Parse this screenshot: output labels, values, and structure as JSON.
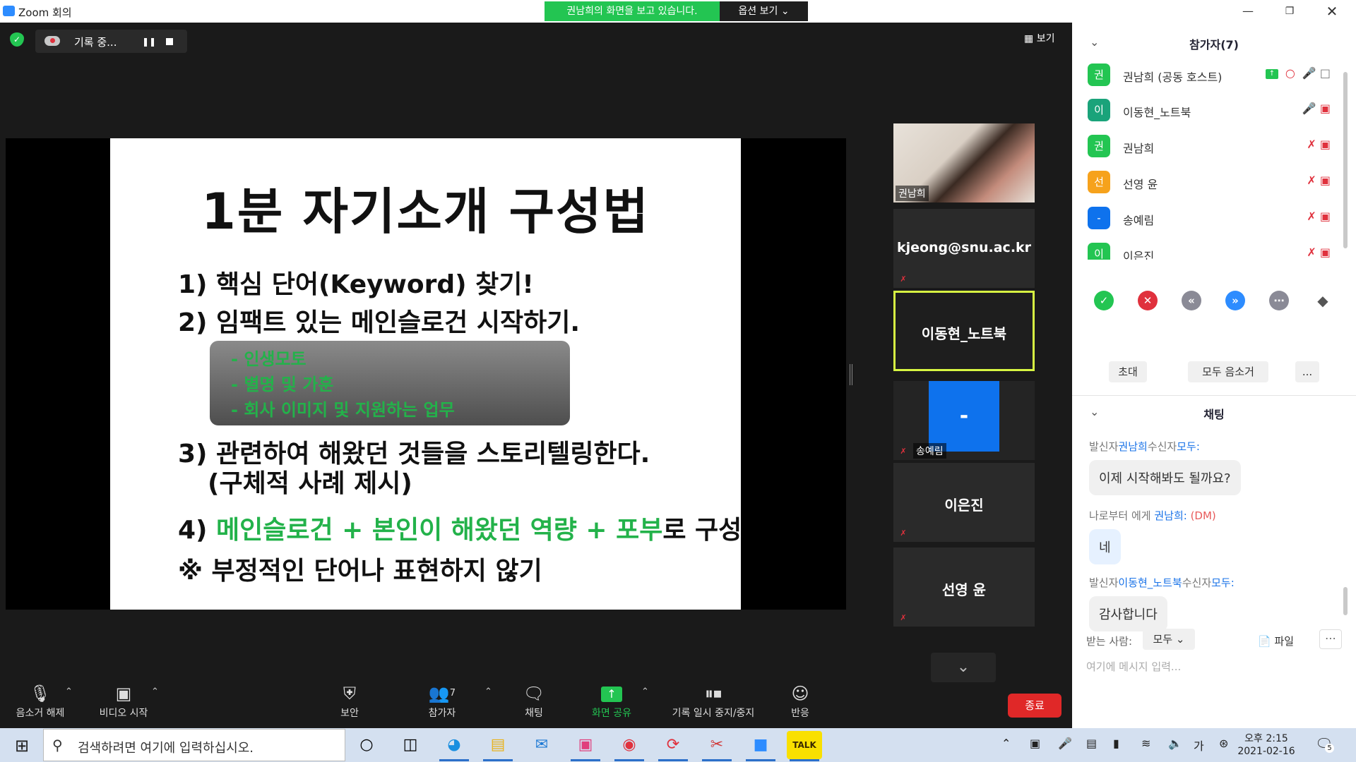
{
  "window": {
    "title": "Zoom 회의",
    "viewing_banner": "권남희의 화면을 보고 있습니다.",
    "view_options": "옵션 보기 ⌄"
  },
  "recording": {
    "status": "기록 중..."
  },
  "view_button": "보기",
  "slide": {
    "title": "1분 자기소개 구성법",
    "line1": "1) 핵심 단어(Keyword) 찾기!",
    "line2": "2) 임팩트 있는 메인슬로건 시작하기.",
    "box_items": [
      "- 인생모토",
      "- 별명 및 가훈",
      "- 회사 이미지 및 지원하는 업무"
    ],
    "line3a": "3) 관련하여 해왔던 것들을 스토리텔링한다.",
    "line3b": "(구체적 사례 제시)",
    "line4_prefix": "4) ",
    "line4_green": "메인슬로건 + 본인이 해왔던 역량 + 포부",
    "line4_suffix": "로 구성",
    "line5": "※ 부정적인 단어나 표현하지 않기"
  },
  "video_tiles": [
    {
      "label": "권남희",
      "type": "camera"
    },
    {
      "label": "kjeong@snu.ac.kr",
      "type": "name"
    },
    {
      "label": "이동현_노트북",
      "type": "name",
      "active": true
    },
    {
      "label": "송예림",
      "type": "avatar",
      "avatar_text": "-"
    },
    {
      "label": "이은진",
      "type": "name"
    },
    {
      "label": "선영 윤",
      "type": "name"
    }
  ],
  "toolbar": {
    "unmute": "음소거 해제",
    "start_video": "비디오 시작",
    "security": "보안",
    "participants": "참가자",
    "participants_count": "7",
    "chat": "채팅",
    "share_screen": "화면 공유",
    "record_pause_stop": "기록 일시 중지/중지",
    "reactions": "반응",
    "end": "종료"
  },
  "participants_panel": {
    "title": "참가자(7)",
    "list": [
      {
        "initial": "권",
        "name": "권남희 (공동 호스트)",
        "color": "#23c552",
        "mic": "on",
        "video": "on"
      },
      {
        "initial": "이",
        "name": "이동현_노트북",
        "color": "#1aa37a",
        "mic": "on",
        "video": "off"
      },
      {
        "initial": "권",
        "name": "권남희",
        "color": "#23c552",
        "mic": "off",
        "video": "off"
      },
      {
        "initial": "선",
        "name": "선영 윤",
        "color": "#f6a21c",
        "mic": "off",
        "video": "off"
      },
      {
        "initial": "-",
        "name": "송예림",
        "color": "#0e72ed",
        "mic": "off",
        "video": "off"
      },
      {
        "initial": "이",
        "name": "이은진",
        "color": "#23c552",
        "mic": "off",
        "video": "off"
      }
    ],
    "invite": "초대",
    "mute_all": "모두 음소거",
    "more": "..."
  },
  "chat_panel": {
    "title": "채팅",
    "messages": [
      {
        "from_prefix": "발신자",
        "from": "권남희",
        "to_prefix": "수신자",
        "to": "모두:",
        "text": "이제 시작해봐도 될까요?"
      },
      {
        "from_prefix": "나로부터 에게 ",
        "from": "권남희:",
        "dm": " (DM)",
        "text": "네"
      },
      {
        "from_prefix": "발신자",
        "from": "이동현_노트북",
        "to_prefix": "수신자",
        "to": "모두:",
        "text": "감사합니다"
      }
    ],
    "to_label": "받는 사람:",
    "to_value": "모두 ⌄",
    "file": "파일",
    "input_placeholder": "여기에 메시지 입력..."
  },
  "taskbar": {
    "search_placeholder": "검색하려면 여기에 입력하십시오.",
    "clock_time": "오후 2:15",
    "clock_date": "2021-02-16",
    "ime": "가",
    "notifications": "5"
  }
}
